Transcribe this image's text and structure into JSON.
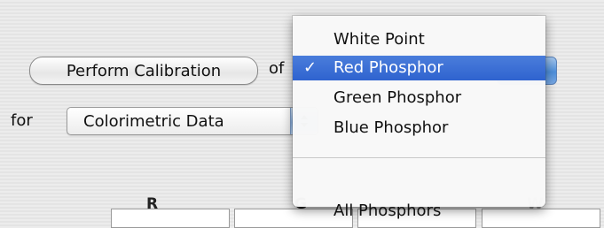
{
  "calibration": {
    "perform_button": "Perform Calibration",
    "of_label": "of",
    "for_label": "for",
    "data_popup_value": "Colorimetric Data"
  },
  "columns": {
    "r": "R",
    "g": "G",
    "w": "W"
  },
  "menu": {
    "items": [
      {
        "label": "White Point",
        "checked": false,
        "highlighted": false
      },
      {
        "label": "Red Phosphor",
        "checked": true,
        "highlighted": true
      },
      {
        "label": "Green Phosphor",
        "checked": false,
        "highlighted": false
      },
      {
        "label": "Blue Phosphor",
        "checked": false,
        "highlighted": false
      },
      {
        "label": "All Phosphors",
        "checked": false,
        "highlighted": false
      }
    ],
    "check_mark": "✓"
  },
  "colors": {
    "highlight": "#3a6fd6",
    "aqua_blue": "#4d8fdb"
  }
}
